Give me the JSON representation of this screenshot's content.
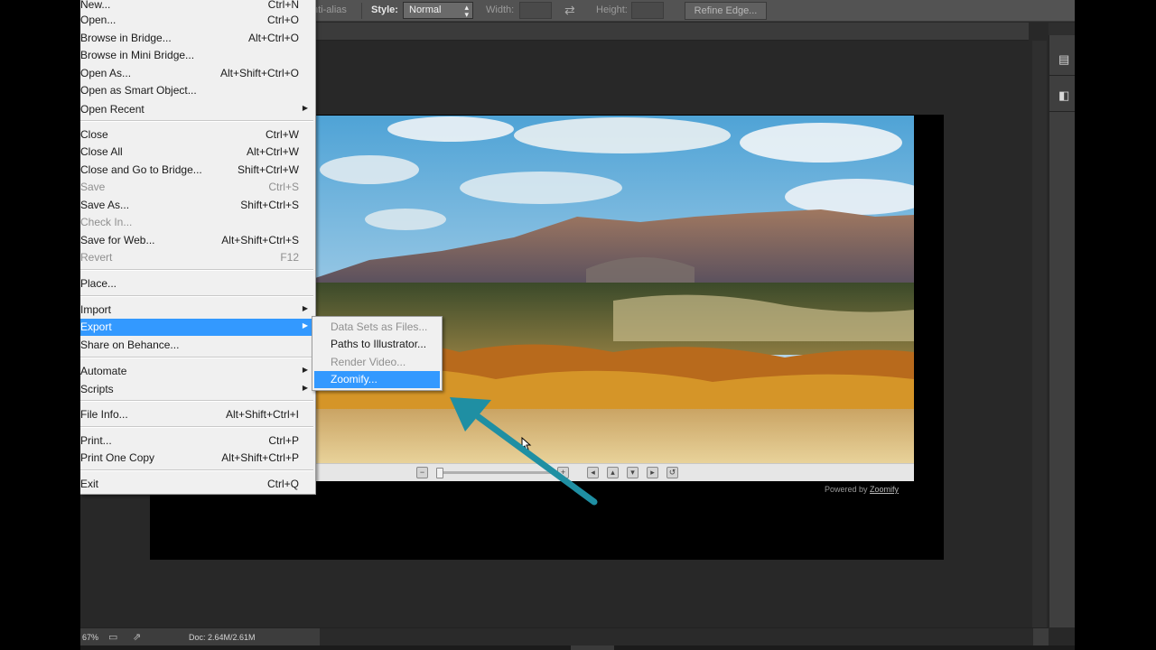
{
  "options_bar": {
    "anti_alias": "nti-alias",
    "style_label": "Style:",
    "style_value": "Normal",
    "width_label": "Width:",
    "height_label": "Height:",
    "refine_edge": "Refine Edge..."
  },
  "file_menu": {
    "items": [
      {
        "label": "New...",
        "shortcut": "Ctrl+N"
      },
      {
        "label": "Open...",
        "shortcut": "Ctrl+O"
      },
      {
        "label": "Browse in Bridge...",
        "shortcut": "Alt+Ctrl+O"
      },
      {
        "label": "Browse in Mini Bridge...",
        "shortcut": ""
      },
      {
        "label": "Open As...",
        "shortcut": "Alt+Shift+Ctrl+O"
      },
      {
        "label": "Open as Smart Object...",
        "shortcut": ""
      },
      {
        "label": "Open Recent",
        "shortcut": ""
      },
      {
        "label": "Close",
        "shortcut": "Ctrl+W"
      },
      {
        "label": "Close All",
        "shortcut": "Alt+Ctrl+W"
      },
      {
        "label": "Close and Go to Bridge...",
        "shortcut": "Shift+Ctrl+W"
      },
      {
        "label": "Save",
        "shortcut": "Ctrl+S"
      },
      {
        "label": "Save As...",
        "shortcut": "Shift+Ctrl+S"
      },
      {
        "label": "Check In...",
        "shortcut": ""
      },
      {
        "label": "Save for Web...",
        "shortcut": "Alt+Shift+Ctrl+S"
      },
      {
        "label": "Revert",
        "shortcut": "F12"
      },
      {
        "label": "Place...",
        "shortcut": ""
      },
      {
        "label": "Import",
        "shortcut": ""
      },
      {
        "label": "Export",
        "shortcut": ""
      },
      {
        "label": "Share on Behance...",
        "shortcut": ""
      },
      {
        "label": "Automate",
        "shortcut": ""
      },
      {
        "label": "Scripts",
        "shortcut": ""
      },
      {
        "label": "File Info...",
        "shortcut": "Alt+Shift+Ctrl+I"
      },
      {
        "label": "Print...",
        "shortcut": "Ctrl+P"
      },
      {
        "label": "Print One Copy",
        "shortcut": "Alt+Shift+Ctrl+P"
      },
      {
        "label": "Exit",
        "shortcut": "Ctrl+Q"
      }
    ]
  },
  "export_submenu": {
    "items": [
      {
        "label": "Data Sets as Files..."
      },
      {
        "label": "Paths to Illustrator..."
      },
      {
        "label": "Render Video..."
      },
      {
        "label": "Zoomify..."
      }
    ]
  },
  "zoomify_viewer": {
    "powered_by": "Powered by",
    "powered_brand": "Zoomify"
  },
  "status_bar": {
    "zoom": "67%",
    "doc_size": "Doc: 2.64M/2.61M"
  },
  "colors": {
    "menu_highlight": "#3399ff",
    "annotation_arrow": "#1f8fa3"
  }
}
